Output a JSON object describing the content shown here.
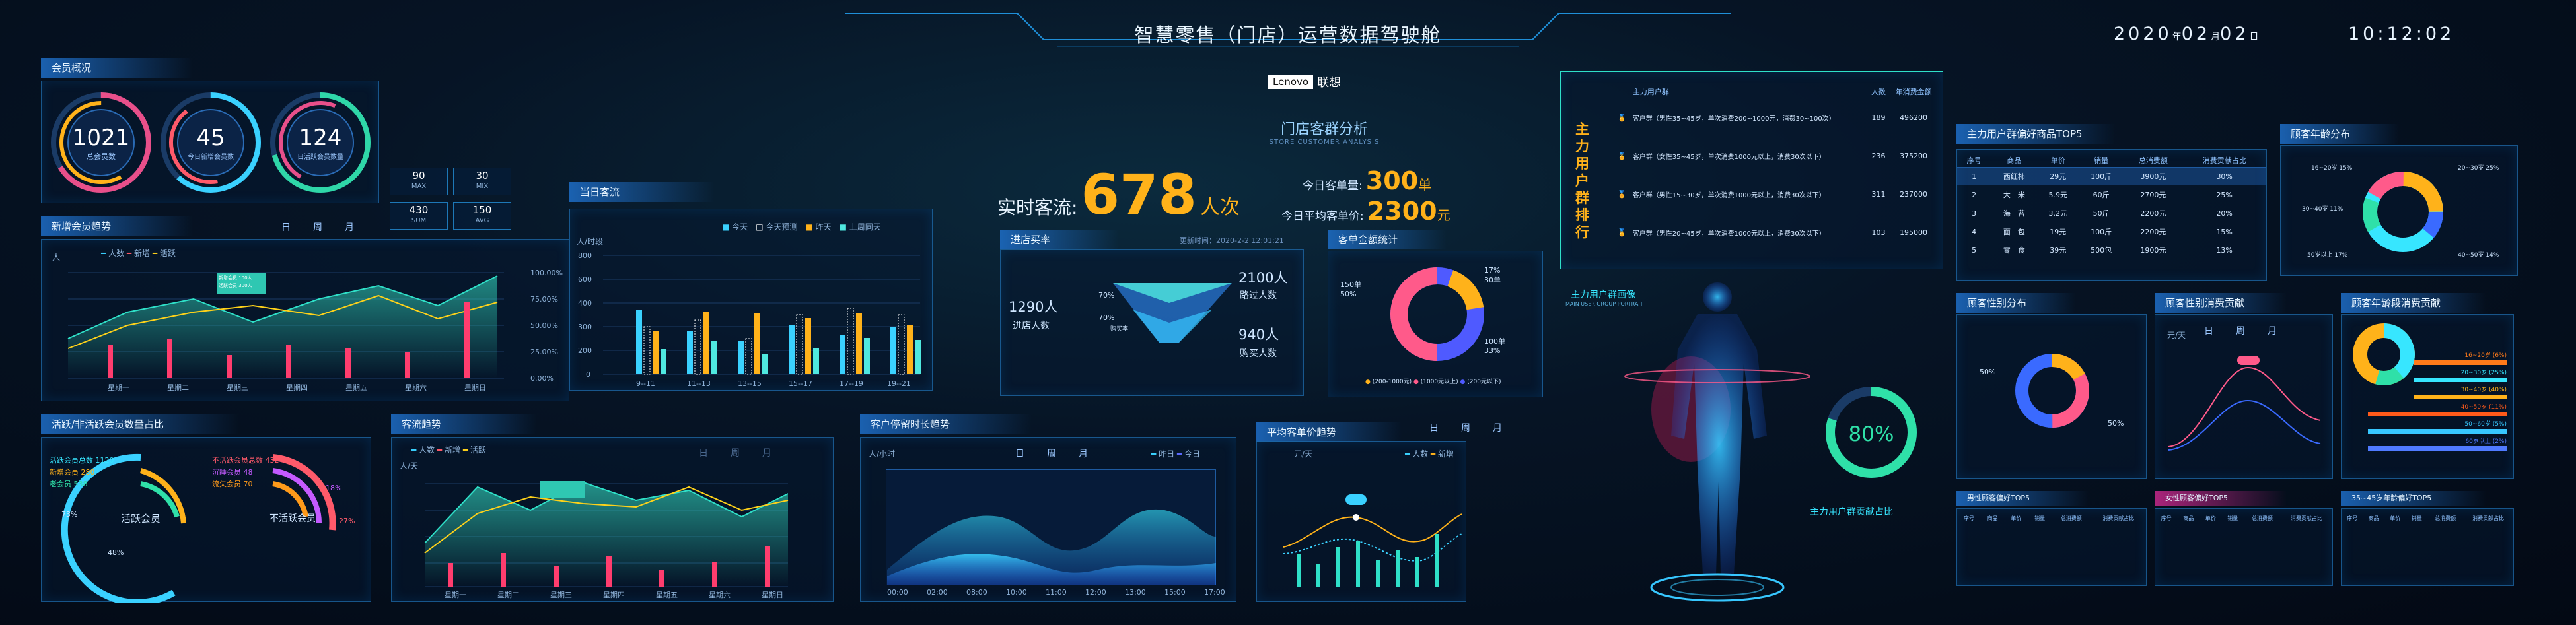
{
  "header": {
    "title": "智慧零售（门店）运营数据驾驶舱",
    "logo_left": "Lenovo",
    "logo_right": "联想",
    "date": "2020",
    "date_year_unit": "年",
    "date_month": "02",
    "date_month_unit": "月",
    "date_day": "02",
    "date_day_unit": "日",
    "time": "10:12:02"
  },
  "center": {
    "subtitle": "门店客群分析",
    "subtitle_en": "STORE CUSTOMER ANALYSIS",
    "realtime_label": "实时客流:",
    "realtime_value": "678",
    "realtime_unit": "人次",
    "today_label": "今日客单量:",
    "today_value": "300",
    "today_unit": "单",
    "avg_label": "今日平均客单价:",
    "avg_value": "2300",
    "avg_unit": "元"
  },
  "member_overview": {
    "title": "会员概况",
    "rings": [
      {
        "value": "1021",
        "label": "总会员数"
      },
      {
        "value": "45",
        "label": "今日新增会员数"
      },
      {
        "value": "124",
        "label": "日活跃会员数量"
      }
    ],
    "stats": [
      {
        "value": "90",
        "label": "MAX"
      },
      {
        "value": "30",
        "label": "MIX"
      },
      {
        "value": "430",
        "label": "SUM"
      },
      {
        "value": "150",
        "label": "AVG"
      }
    ]
  },
  "new_member_trend": {
    "title": "新增会员趋势",
    "tabs": [
      "日",
      "周",
      "月"
    ],
    "legend": [
      "人数",
      "新增",
      "活跃"
    ],
    "ylabel": "人",
    "callout": "新增会员 100人\n活跃会员 300人"
  },
  "active_ratio": {
    "title": "活跃/非活跃会员数量占比",
    "left": [
      {
        "label": "活跃会员总数",
        "value": "1120"
      },
      {
        "label": "新增会员",
        "value": "280"
      },
      {
        "label": "老会员",
        "value": "538"
      }
    ],
    "right": [
      {
        "label": "不活跃会员总数",
        "value": "432"
      },
      {
        "label": "沉睡会员",
        "value": "48"
      },
      {
        "label": "流失会员",
        "value": "70"
      }
    ],
    "pct_left": "73%",
    "pct_mid": "48%",
    "pct_right": "27%",
    "pct_right2": "18%",
    "name_left": "活跃会员",
    "name_right": "不活跃会员"
  },
  "today_flow": {
    "title": "当日客流",
    "legend": [
      "今天",
      "今天预测",
      "昨天",
      "上周同天"
    ],
    "ylabel": "人/时段"
  },
  "flow_trend": {
    "title": "客流趋势",
    "tabs": [
      "日",
      "周",
      "月"
    ],
    "legend": [
      "人数",
      "新增",
      "活跃"
    ],
    "ylabel": "人/天"
  },
  "dwell": {
    "title": "客户停留时长趋势",
    "tabs": [
      "日",
      "周",
      "月"
    ],
    "ylabel": "人/小时",
    "legend": [
      "昨日",
      "今日"
    ]
  },
  "funnel": {
    "title": "进店买率",
    "time": "更新时间：2020-2-2 12:01:21",
    "enter": "1290人",
    "enter_label": "进店人数",
    "pct1": "70%",
    "pct2": "70%",
    "buy_label": "购买率",
    "pass": "2100人",
    "pass_label": "路过人数",
    "buy": "940人",
    "buy_label2": "购买人数"
  },
  "order_stats": {
    "title": "客单金额统计",
    "a_label": "150单",
    "a_pct": "50%",
    "b_label": "17%",
    "b_val": "30单",
    "c_label": "100单",
    "c_pct": "33%",
    "legend": [
      "(200-1000元)",
      "(1000元以上)",
      "(200元以下)"
    ]
  },
  "avg_price": {
    "title": "平均客单价趋势",
    "tabs": [
      "日",
      "周",
      "月"
    ],
    "ylabel": "元/天",
    "legend": [
      "人数",
      "新增"
    ]
  },
  "ranking": {
    "vertical_title": "主力用户群排行",
    "headers": [
      "主力用户群",
      "人数",
      "年消费金额"
    ],
    "rows": [
      {
        "desc": "客户群（男性35~45岁，单次消费200~1000元，消费30~100次）",
        "count": "189",
        "amount": "496200"
      },
      {
        "desc": "客户群（女性35~45岁，单次消费1000元以上，消费30次以下）",
        "count": "236",
        "amount": "375200"
      },
      {
        "desc": "客户群（男性15~30岁，单次消费1000元以上，消费30次以下）",
        "count": "311",
        "amount": "237000"
      },
      {
        "desc": "客户群（男性20~45岁，单次消费1000元以上，消费30次以下）",
        "count": "103",
        "amount": "195000"
      }
    ]
  },
  "portrait": {
    "title": "主力用户群画像",
    "subtitle": "MAIN USER GROUP PORTRAIT",
    "contrib": "主力用户群贡献占比",
    "pct": "80%"
  },
  "top5": {
    "title": "主力用户群偏好商品TOP5",
    "headers": [
      "序号",
      "商品",
      "单价",
      "销量",
      "总消费额",
      "消费贡献占比"
    ],
    "rows": [
      [
        "1",
        "西红柿",
        "29元",
        "100斤",
        "3900元",
        "30%"
      ],
      [
        "2",
        "大　米",
        "5.9元",
        "60斤",
        "2700元",
        "25%"
      ],
      [
        "3",
        "海　苔",
        "3.2元",
        "50斤",
        "2200元",
        "20%"
      ],
      [
        "4",
        "面　包",
        "19元",
        "100斤",
        "2200元",
        "15%"
      ],
      [
        "5",
        "零　食",
        "39元",
        "500包",
        "1900元",
        "13%"
      ]
    ]
  },
  "age_dist": {
    "title": "顾客年龄分布",
    "labels": [
      "16~20岁 15%",
      "20~30岁 25%",
      "30~40岁 11%",
      "50岁以上 17%",
      "40~50岁 14%"
    ]
  },
  "gender_dist": {
    "title": "顾客性别分布",
    "pct_left": "50%",
    "pct_right": "50%"
  },
  "gender_contrib": {
    "title": "顾客性别消费贡献",
    "tabs": [
      "日",
      "周",
      "月"
    ],
    "ylabel": "元/天"
  },
  "age_contrib": {
    "title": "顾客年龄段消费贡献",
    "bars": [
      "16~20岁 (6%)",
      "20~30岁 (25%)",
      "30~40岁 (40%)",
      "40~50岁 (11%)",
      "50~60岁 (5%)",
      "60岁以上 (2%)"
    ]
  },
  "male_top5": {
    "title": "男性顾客偏好TOP5",
    "headers": [
      "序号",
      "商品",
      "单价",
      "销量",
      "总消费额",
      "消费贡献占比"
    ]
  },
  "female_top5": {
    "title": "女性顾客偏好TOP5",
    "headers": [
      "序号",
      "商品",
      "单价",
      "销量",
      "总消费额",
      "消费贡献占比"
    ]
  },
  "age_top5": {
    "title": "35~45岁年龄偏好TOP5",
    "headers": [
      "序号",
      "商品",
      "单价",
      "销量",
      "总消费额",
      "消费贡献占比"
    ]
  }
}
